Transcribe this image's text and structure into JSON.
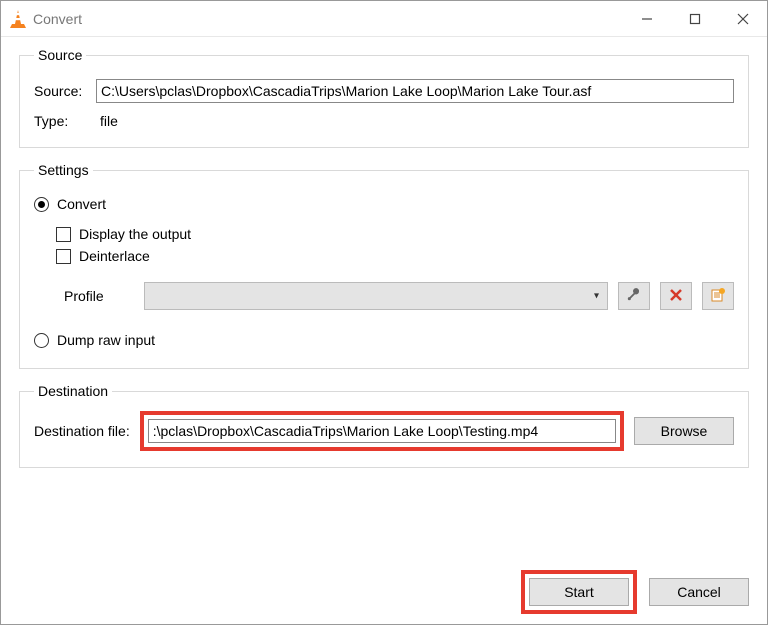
{
  "window": {
    "title": "Convert"
  },
  "source": {
    "legend": "Source",
    "source_label": "Source:",
    "source_value": "C:\\Users\\pclas\\Dropbox\\CascadiaTrips\\Marion Lake Loop\\Marion Lake Tour.asf",
    "type_label": "Type:",
    "type_value": "file"
  },
  "settings": {
    "legend": "Settings",
    "convert_label": "Convert",
    "display_output_label": "Display the output",
    "deinterlace_label": "Deinterlace",
    "profile_label": "Profile",
    "profile_value": "",
    "dump_label": "Dump raw input"
  },
  "destination": {
    "legend": "Destination",
    "dest_label": "Destination file:",
    "dest_value": ":\\pclas\\Dropbox\\CascadiaTrips\\Marion Lake Loop\\Testing.mp4",
    "browse_label": "Browse"
  },
  "buttons": {
    "start": "Start",
    "cancel": "Cancel"
  }
}
